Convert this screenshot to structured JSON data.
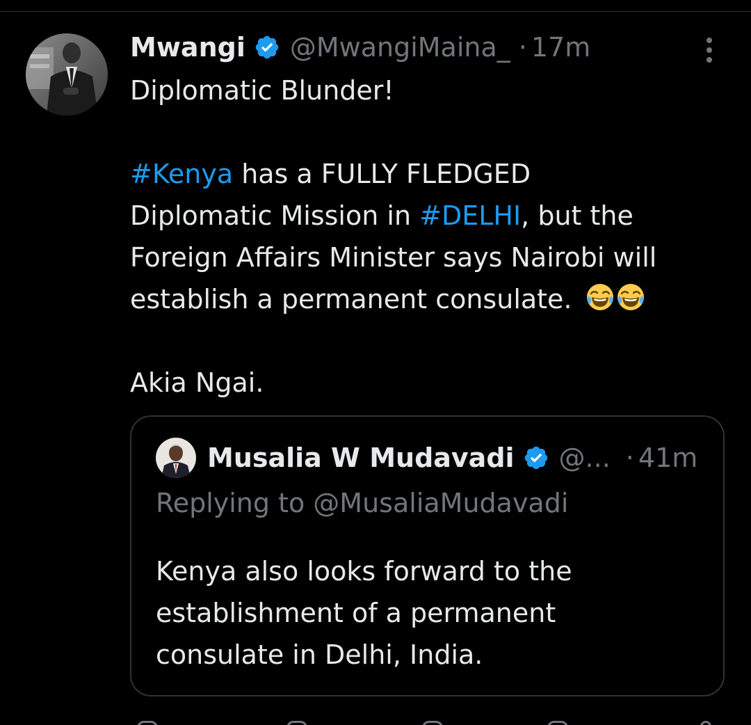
{
  "tweet": {
    "author_name": "Mwangi",
    "handle": "@MwangiMaina_",
    "separator": "·",
    "time": "17m",
    "text_lines": {
      "line1": "Diplomatic Blunder!",
      "hashtag1": "#Kenya",
      "line2_rest": " has a FULLY FLEDGED",
      "line3_start": "Diplomatic Mission in ",
      "hashtag2": "#DELHI",
      "line3_rest": ", but the",
      "line4": "Foreign Affairs Minister says Nairobi will",
      "line5": "establish a permanent consulate. ",
      "line6": "Akia Ngai."
    },
    "emojis": [
      "face-with-tears-of-joy",
      "face-with-tears-of-joy"
    ]
  },
  "quoted_tweet": {
    "author_name": "Musalia W Mudavadi",
    "handle": "@...",
    "separator": "·",
    "time": "41m",
    "replying_to": "Replying to @MusaliaMudavadi",
    "text_lines": {
      "line1": "Kenya also looks forward to the",
      "line2": "establishment of a permanent",
      "line3": "consulate in Delhi, India."
    }
  },
  "colors": {
    "background": "#000000",
    "text": "#e7e9ea",
    "secondary": "#71767b",
    "link": "#1d9bf0",
    "verified": "#1d9bf0",
    "border": "#2f3336"
  },
  "icons": {
    "verified": "verified-badge-icon",
    "more": "more-options-icon"
  }
}
